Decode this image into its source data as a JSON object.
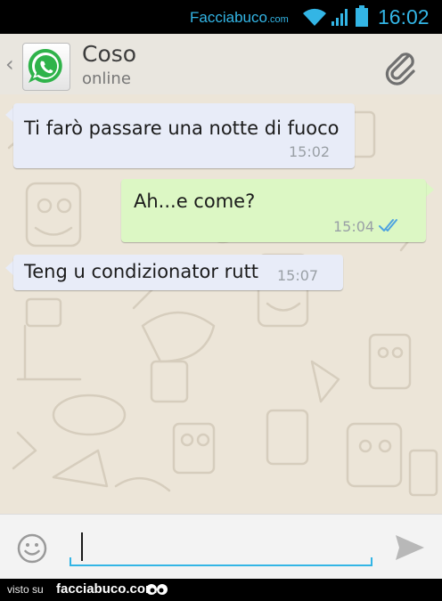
{
  "status_bar": {
    "watermark": "Facciabuco",
    "watermark_suffix": ".com",
    "time": "16:02",
    "icons": [
      "wifi-icon",
      "signal-icon",
      "battery-icon"
    ],
    "accent_color": "#33b5e5"
  },
  "action_bar": {
    "back_icon": "‹",
    "contact_name": "Coso",
    "contact_status": "online",
    "avatar_icon": "whatsapp-logo-icon",
    "attach_icon": "paperclip-icon"
  },
  "messages": [
    {
      "direction": "incoming",
      "text": "Ti farò passare una notte di fuoco",
      "time": "15:02"
    },
    {
      "direction": "outgoing",
      "text": "Ah...e come?",
      "time": "15:04",
      "status_icon": "double-check-icon"
    },
    {
      "direction": "incoming",
      "text": "Teng u condizionator rutt",
      "time": "15:07"
    }
  ],
  "input_bar": {
    "emoji_icon": "smiley-icon",
    "message_value": "",
    "send_icon": "send-icon"
  },
  "footer": {
    "prefix": "visto su",
    "site": "facciabuco.com",
    "logo_icon": "eyes-icon"
  },
  "colors": {
    "incoming_bubble": "#e8ecf8",
    "outgoing_bubble": "#dcf7c4",
    "chat_background": "#ece5d8",
    "whatsapp_green": "#25d366"
  }
}
